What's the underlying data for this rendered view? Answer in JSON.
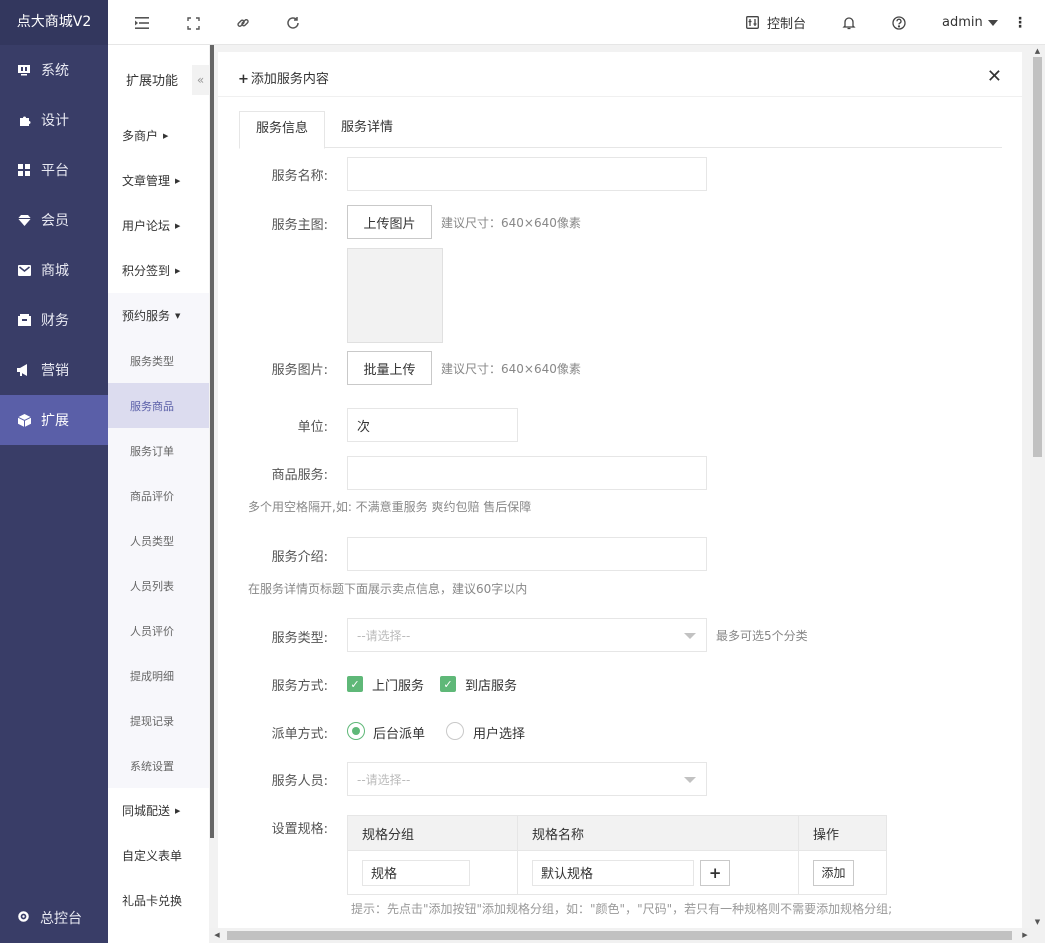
{
  "brand": "点大商城V2",
  "sidebar": {
    "items": [
      {
        "label": "系统",
        "icon": "monitor-icon"
      },
      {
        "label": "设计",
        "icon": "puzzle-icon"
      },
      {
        "label": "平台",
        "icon": "grid-icon"
      },
      {
        "label": "会员",
        "icon": "diamond-icon"
      },
      {
        "label": "商城",
        "icon": "mail-icon"
      },
      {
        "label": "财务",
        "icon": "wallet-icon"
      },
      {
        "label": "营销",
        "icon": "megaphone-icon"
      },
      {
        "label": "扩展",
        "icon": "cube-icon"
      }
    ],
    "active": "扩展",
    "bottom_label": "总控台"
  },
  "header": {
    "console_label": "控制台",
    "user": "admin"
  },
  "submenu": {
    "title": "扩展功能",
    "groups": [
      "多商户",
      "文章管理",
      "用户论坛",
      "积分签到",
      "预约服务"
    ],
    "subs": [
      "服务类型",
      "服务商品",
      "服务订单",
      "商品评价",
      "人员类型",
      "人员列表",
      "人员评价",
      "提成明细",
      "提现记录",
      "系统设置"
    ],
    "after": [
      "同城配送",
      "自定义表单",
      "礼品卡兑换"
    ],
    "active_sub": "服务商品"
  },
  "panel": {
    "title": "添加服务内容",
    "tabs": [
      "服务信息",
      "服务详情"
    ]
  },
  "form": {
    "name_label": "服务名称:",
    "main_img_label": "服务主图:",
    "upload_btn": "上传图片",
    "size_hint": "建议尺寸：640×640像素",
    "imgs_label": "服务图片:",
    "batch_btn": "批量上传",
    "size_hint2": "建议尺寸：640×640像素",
    "unit_label": "单位:",
    "unit_value": "次",
    "goods_service_label": "商品服务:",
    "goods_service_hint": "多个用空格隔开,如: 不满意重服务 爽约包赔 售后保障",
    "intro_label": "服务介绍:",
    "intro_hint": "在服务详情页标题下面展示卖点信息，建议60字以内",
    "type_label": "服务类型:",
    "type_placeholder": "--请选择--",
    "type_hint": "最多可选5个分类",
    "mode_label": "服务方式:",
    "mode_opt1": "上门服务",
    "mode_opt2": "到店服务",
    "dispatch_label": "派单方式:",
    "dispatch_opt1": "后台派单",
    "dispatch_opt2": "用户选择",
    "staff_label": "服务人员:",
    "staff_placeholder": "--请选择--",
    "spec_label": "设置规格:",
    "spec_th1": "规格分组",
    "spec_th2": "规格名称",
    "spec_th3": "操作",
    "spec_group_value": "规格",
    "spec_name_value": "默认规格",
    "spec_add_btn": "添加",
    "spec_hint": "提示：先点击\"添加按钮\"添加规格分组，如：\"颜色\"，\"尺码\"，若只有一种规格则不需要添加规格分组;"
  }
}
